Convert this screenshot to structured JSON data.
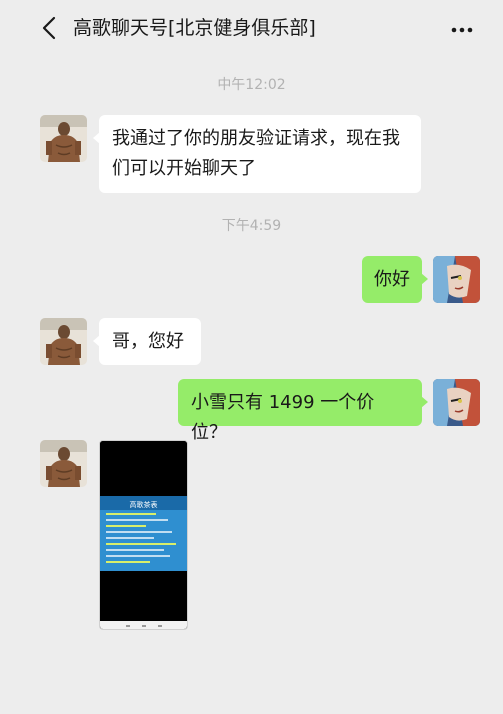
{
  "header": {
    "title": "高歌聊天号[北京健身俱乐部]",
    "back_icon": "chevron-left-icon",
    "more_icon": "ellipsis-icon"
  },
  "messages": {
    "time1": "中午12:02",
    "msg1": "我通过了你的朋友验证请求，现在我们可以开始聊天了",
    "time2": "下午4:59",
    "msg2": "你好",
    "msg3": "哥，您好",
    "msg4": "小雪只有 1499 一个价位？"
  },
  "image_message": {
    "title": "高歌茶表"
  },
  "colors": {
    "background": "#ededed",
    "incoming_bubble": "#ffffff",
    "outgoing_bubble": "#95ec69"
  }
}
